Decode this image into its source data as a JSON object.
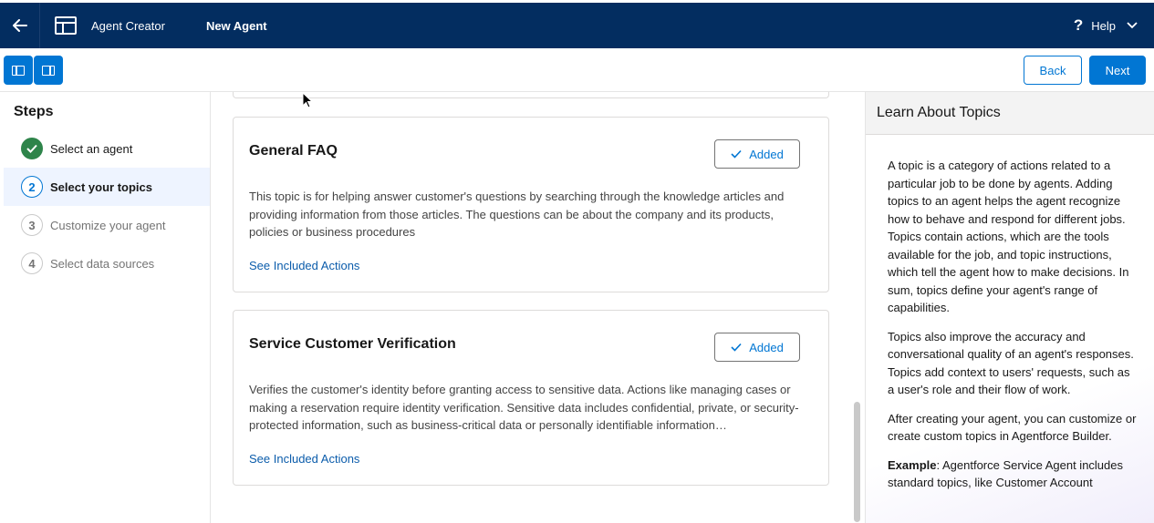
{
  "header": {
    "app_name": "Agent Creator",
    "page_name": "New Agent",
    "help_label": "Help",
    "back_icon": "arrow-left-icon",
    "app_icon": "app-layout-icon"
  },
  "toolbar": {
    "toggle_left_icon": "left-panel-icon",
    "toggle_right_icon": "right-panel-icon",
    "back_label": "Back",
    "next_label": "Next"
  },
  "steps": {
    "title": "Steps",
    "items": [
      {
        "num": "",
        "label": "Select an agent",
        "state": "done"
      },
      {
        "num": "2",
        "label": "Select your topics",
        "state": "active"
      },
      {
        "num": "3",
        "label": "Customize your agent",
        "state": "pending"
      },
      {
        "num": "4",
        "label": "Select data sources",
        "state": "pending"
      }
    ]
  },
  "topics": [
    {
      "title": "General FAQ",
      "status_label": "Added",
      "description": "This topic is for helping answer customer's questions by searching through the knowledge articles and providing information from those articles. The questions can be about the company and its products, policies or business procedures",
      "link": "See Included Actions"
    },
    {
      "title": "Service Customer Verification",
      "status_label": "Added",
      "description": "Verifies the customer's identity before granting access to sensitive data. Actions like managing cases or making a reservation require identity verification. Sensitive data includes confidential, private, or security-protected information, such as business-critical data or personally identifiable information…",
      "link": "See Included Actions"
    }
  ],
  "help_panel": {
    "title": "Learn About Topics",
    "paragraphs": [
      "A topic is a category of actions related to a particular job to be done by agents. Adding topics to an agent helps the agent recognize how to behave and respond for different jobs. Topics contain actions, which are the tools available for the job, and topic instructions, which tell the agent how to make decisions. In sum, topics define your agent's range of capabilities.",
      "Topics also improve the accuracy and conversational quality of an agent's responses. Topics add context to users' requests, such as a user's role and their flow of work.",
      "After creating your agent, you can customize or create custom topics in Agentforce Builder."
    ],
    "example_label": "Example",
    "example_text": ": Agentforce Service Agent includes standard topics, like Customer Account"
  },
  "colors": {
    "header_bg": "#032d60",
    "brand": "#0176d3",
    "success": "#2e844a",
    "active_step_bg": "#eef4ff"
  }
}
